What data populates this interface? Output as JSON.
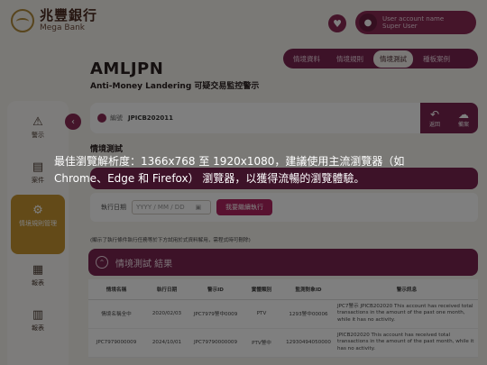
{
  "brand": {
    "name_cn": "兆豐銀行",
    "name_en": "Mega Bank"
  },
  "user": {
    "account_name": "User account name",
    "role": "Super User"
  },
  "tabs": [
    {
      "label": "情境資料"
    },
    {
      "label": "情境規則"
    },
    {
      "label": "情境測試"
    },
    {
      "label": "種板案例"
    }
  ],
  "page": {
    "title": "AMLJPN",
    "subtitle": "Anti-Money Landering 可疑交易監控警示"
  },
  "sidebar": {
    "items": [
      {
        "label": "警示",
        "icon": "alert-icon"
      },
      {
        "label": "案件",
        "icon": "case-icon"
      },
      {
        "label": "情境規則管理",
        "icon": "rules-icon"
      },
      {
        "label": "報表",
        "icon": "report-icon"
      },
      {
        "label": "報表",
        "icon": "chart-icon"
      }
    ]
  },
  "case": {
    "label": "編號",
    "id": "JPICB202011",
    "action_back": "返回",
    "action_upload": "備案"
  },
  "section": {
    "title": "情境測試"
  },
  "form": {
    "date_label": "執行日期",
    "date_placeholder": "YYYY / MM / DD",
    "submit_label": "我要繼續執行"
  },
  "note": "(顯示了執行條件執行任務等於下方試用於式資料解用，需程式時可刪除)",
  "results": {
    "title": "情境測試 結果",
    "columns": [
      "情境名稱",
      "執行日期",
      "警示ID",
      "實體類別",
      "監測對象ID",
      "警示訊息"
    ],
    "rows": [
      [
        "情境名稱全中",
        "2020/02/03",
        "JPC7979警中0009",
        "PTV",
        "1293警中00006",
        "JPC7警示 JPICB202020 This account has received total transactions in the amount of the past one month, while it has no activity."
      ],
      [
        "JPC7979000009",
        "2024/10/01",
        "JPC79790000009",
        "PTV警中",
        "12930494050000",
        "JPICB202020 This account has received total transactions in the amount of the past month, while it has no activity."
      ]
    ]
  },
  "modal": {
    "line1": "最佳瀏覽解析度：1366x768 至 1920x1080，建議使用主流瀏覽器（如",
    "line2": "Chrome、Edge 和 Firefox） 瀏覽器，以獲得流暢的瀏覽體驗。"
  }
}
